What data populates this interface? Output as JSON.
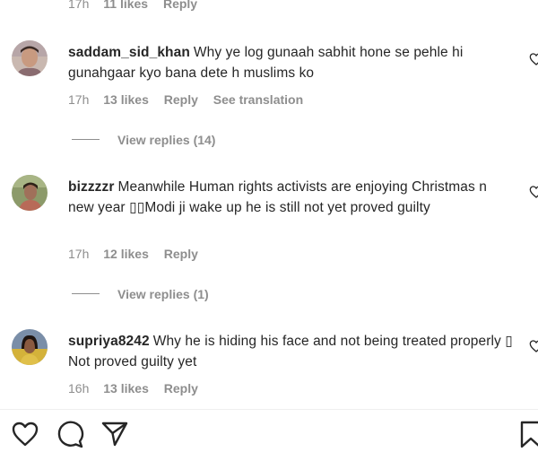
{
  "top_meta": {
    "time": "17h",
    "likes": "11 likes",
    "reply": "Reply"
  },
  "comments": [
    {
      "username": "saddam_sid_khan",
      "text": "Why ye log gunaah sabhit hone se pehle hi gunahgaar kyo bana dete h muslims ko",
      "time": "17h",
      "likes": "13 likes",
      "reply": "Reply",
      "translation": "See translation",
      "view_replies": "View replies (14)"
    },
    {
      "username": "bizzzzr",
      "text": "Meanwhile Human rights activists are enjoying Christmas n new year ▯▯Modi ji wake up he is still not yet proved guilty",
      "time": "17h",
      "likes": "12 likes",
      "reply": "Reply",
      "view_replies": "View replies (1)"
    },
    {
      "username": "supriya8242",
      "text": "Why he is hiding his face and not being treated properly ▯ Not proved guilty yet",
      "time": "16h",
      "likes": "13 likes",
      "reply": "Reply"
    }
  ],
  "icons": {
    "like": "heart-icon",
    "comment": "comment-icon",
    "share": "send-icon",
    "save": "bookmark-icon"
  },
  "colors": {
    "text": "#262626",
    "secondary": "#8e8e8e",
    "background": "#ffffff"
  }
}
